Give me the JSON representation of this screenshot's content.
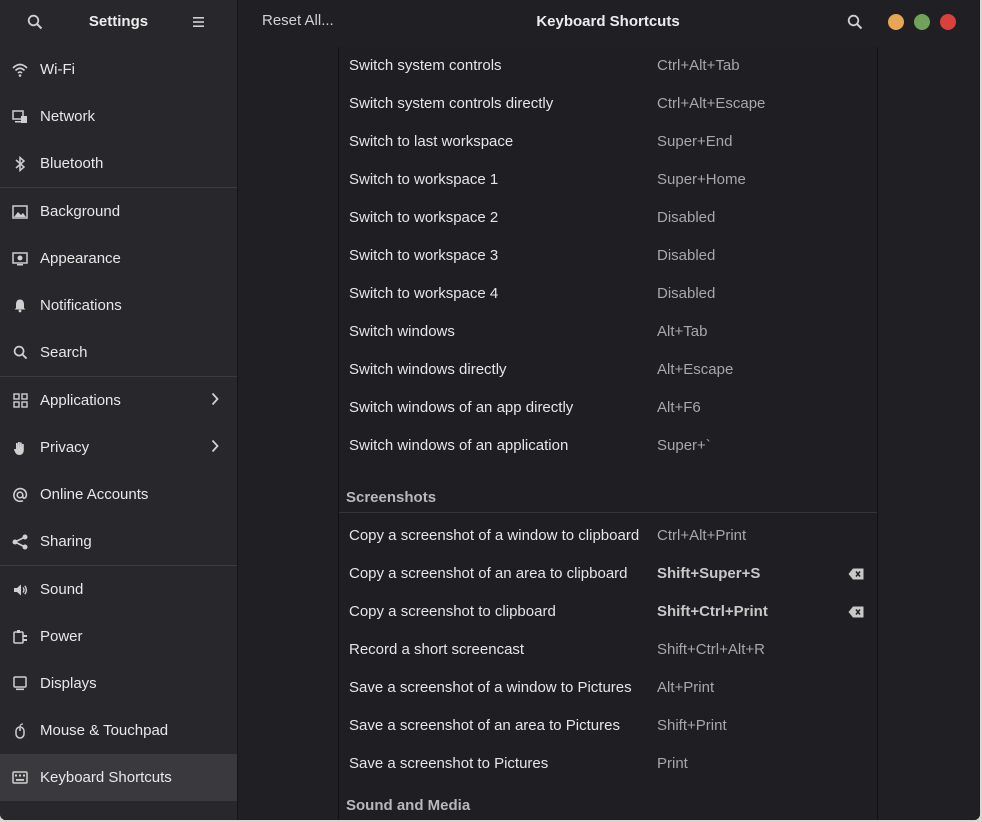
{
  "sidebar": {
    "title": "Settings",
    "search_icon": "search-icon",
    "menu_icon": "hamburger-menu-icon",
    "items": [
      {
        "label": "Wi-Fi",
        "icon": "wifi-icon"
      },
      {
        "label": "Network",
        "icon": "network-icon"
      },
      {
        "label": "Bluetooth",
        "icon": "bluetooth-icon"
      },
      {
        "label": "Background",
        "icon": "background-icon"
      },
      {
        "label": "Appearance",
        "icon": "appearance-icon"
      },
      {
        "label": "Notifications",
        "icon": "bell-icon"
      },
      {
        "label": "Search",
        "icon": "search-icon"
      },
      {
        "label": "Applications",
        "icon": "grid-icon",
        "chevron": true
      },
      {
        "label": "Privacy",
        "icon": "hand-icon",
        "chevron": true
      },
      {
        "label": "Online Accounts",
        "icon": "at-icon"
      },
      {
        "label": "Sharing",
        "icon": "share-icon"
      },
      {
        "label": "Sound",
        "icon": "speaker-icon"
      },
      {
        "label": "Power",
        "icon": "plug-icon"
      },
      {
        "label": "Displays",
        "icon": "monitor-icon"
      },
      {
        "label": "Mouse & Touchpad",
        "icon": "mouse-icon"
      },
      {
        "label": "Keyboard Shortcuts",
        "icon": "keyboard-icon",
        "selected": true
      }
    ]
  },
  "header": {
    "reset_label": "Reset All...",
    "title": "Keyboard Shortcuts"
  },
  "colors": {
    "minimize": "#e8a555",
    "maximize": "#6fa357",
    "close": "#d9413c",
    "window_bg": "#1f1f24",
    "sidebar_bg": "#27272c",
    "selected_bg": "#3a3a3e"
  },
  "shortcuts": {
    "navigation_rows": [
      {
        "name": "Switch system controls",
        "accel": "Ctrl+Alt+Tab"
      },
      {
        "name": "Switch system controls directly",
        "accel": "Ctrl+Alt+Escape"
      },
      {
        "name": "Switch to last workspace",
        "accel": "Super+End"
      },
      {
        "name": "Switch to workspace 1",
        "accel": "Super+Home"
      },
      {
        "name": "Switch to workspace 2",
        "accel": "Disabled"
      },
      {
        "name": "Switch to workspace 3",
        "accel": "Disabled"
      },
      {
        "name": "Switch to workspace 4",
        "accel": "Disabled"
      },
      {
        "name": "Switch windows",
        "accel": "Alt+Tab"
      },
      {
        "name": "Switch windows directly",
        "accel": "Alt+Escape"
      },
      {
        "name": "Switch windows of an app directly",
        "accel": "Alt+F6"
      },
      {
        "name": "Switch windows of an application",
        "accel": "Super+`"
      }
    ],
    "screenshots_title": "Screenshots",
    "screenshot_rows": [
      {
        "name": "Copy a screenshot of a window to clipboard",
        "accel": "Ctrl+Alt+Print"
      },
      {
        "name": "Copy a screenshot of an area to clipboard",
        "accel": "Shift+Super+S",
        "custom": true
      },
      {
        "name": "Copy a screenshot to clipboard",
        "accel": "Shift+Ctrl+Print",
        "custom": true
      },
      {
        "name": "Record a short screencast",
        "accel": "Shift+Ctrl+Alt+R"
      },
      {
        "name": "Save a screenshot of a window to Pictures",
        "accel": "Alt+Print"
      },
      {
        "name": "Save a screenshot of an area to Pictures",
        "accel": "Shift+Print"
      },
      {
        "name": "Save a screenshot to Pictures",
        "accel": "Print"
      }
    ],
    "sound_title": "Sound and Media"
  }
}
